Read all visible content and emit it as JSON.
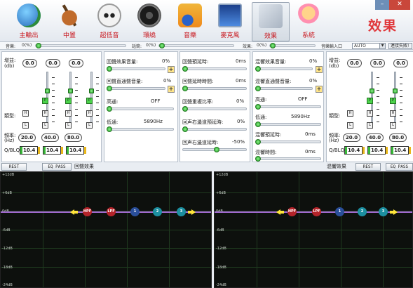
{
  "toolbar": {
    "items": [
      {
        "label": "主輸出",
        "icon": "globe-icon"
      },
      {
        "label": "中置",
        "icon": "guitar-icon"
      },
      {
        "label": "超低音",
        "icon": "stormtrooper-icon"
      },
      {
        "label": "環繞",
        "icon": "speaker-icon"
      },
      {
        "label": "音樂",
        "icon": "music-note-icon"
      },
      {
        "label": "麥克風",
        "icon": "monitor-microphone-icon"
      },
      {
        "label": "效果",
        "icon": "effects-icon"
      },
      {
        "label": "系統",
        "icon": "system-character-icon"
      }
    ],
    "active": "效果",
    "page_title": "效果"
  },
  "volume_bar": {
    "music_label": "音樂:",
    "music_value": "0(%)",
    "mic_label": "話筒:",
    "mic_value": "0(%)",
    "effect_label": "效果:",
    "effect_value": "0(%)",
    "input_label": "音樂輸入口",
    "input_value": "AUTO",
    "link_label": "連接失敗!"
  },
  "eq_left": {
    "gain_label": "增益:",
    "gain_unit": "(db)",
    "gains": [
      "0.0",
      "0.0",
      "0.0"
    ],
    "type_label": "類型:",
    "freq_label": "頻率:",
    "freq_unit": "(Hz)",
    "freqs": [
      "20.0",
      "40.0",
      "80.0"
    ],
    "q_label": "Q/BLQ:",
    "qs": [
      "10.4",
      "10.4",
      "10.4"
    ]
  },
  "eq_right": {
    "gain_label": "增益:",
    "gain_unit": "(db)",
    "gains": [
      "0.0",
      "0.0",
      "0.0"
    ],
    "type_label": "類型:",
    "freq_label": "頻率:",
    "freq_unit": "(Hz)",
    "freqs": [
      "20.0",
      "40.0",
      "80.0"
    ],
    "q_label": "Q/BLQ:",
    "qs": [
      "10.4",
      "10.4",
      "10.4"
    ]
  },
  "echo_panel": {
    "items": [
      {
        "label": "回聲效果音量:",
        "value": "0%"
      },
      {
        "label": "回聲直通聲音量:",
        "value": "0%"
      },
      {
        "label": "高通:",
        "value": "OFF"
      },
      {
        "label": "低通:",
        "value": "5890Hz"
      }
    ]
  },
  "delay_panel": {
    "items": [
      {
        "label": "回聲預延時:",
        "value": "0ms"
      },
      {
        "label": "回聲延時時間:",
        "value": "0ms"
      },
      {
        "label": "回聲重複比率:",
        "value": "0%"
      },
      {
        "label": "回声右邊道預延時:",
        "value": "0%"
      },
      {
        "label": "回声右邊道延時:",
        "value": "-50%"
      }
    ]
  },
  "reverb_panel": {
    "items": [
      {
        "label": "混響效果音量:",
        "value": "0%"
      },
      {
        "label": "混響直通聲音量:",
        "value": "0%"
      },
      {
        "label": "高通:",
        "value": "OFF"
      },
      {
        "label": "低通:",
        "value": "5890Hz"
      },
      {
        "label": "混響預延時:",
        "value": "0ms"
      },
      {
        "label": "混響時間:",
        "value": "0ms"
      }
    ]
  },
  "bottom_left": {
    "reset": "REST",
    "bypass": "EQ PASS",
    "section": "回聲效果"
  },
  "bottom_right": {
    "section": "混響效果",
    "reset": "REST",
    "bypass": "EQ PASS"
  },
  "graph": {
    "db_labels": [
      "+12dB",
      "+6dB",
      "0dB",
      "-6dB",
      "-12dB",
      "-18dB",
      "-24dB"
    ],
    "nodes": [
      "HPF",
      "LPF",
      "1",
      "2",
      "3"
    ]
  },
  "colors": {
    "accent_red": "#c8161d",
    "knob_green": "#1aa11a",
    "graph_bg": "#0d100d",
    "grid": "#1f3a1f",
    "curve": "#a26ad0",
    "arrow": "#ffe53a",
    "node_red": "#b4242a",
    "node_blue": "#2a4f9a",
    "node_cyan": "#1c8fa0"
  }
}
